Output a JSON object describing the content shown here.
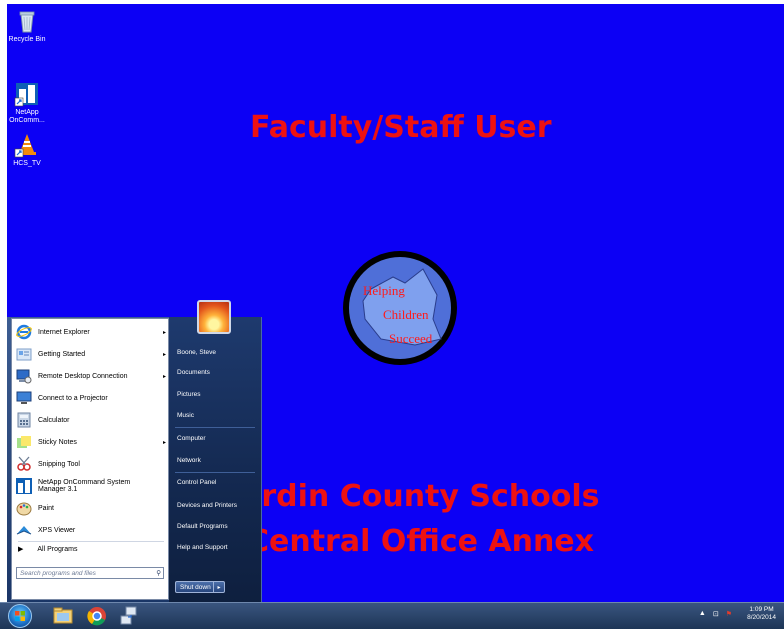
{
  "desktop": {
    "background_color": "#0c00f5",
    "icons": [
      {
        "label": "Recycle Bin",
        "icon": "recycle-bin-icon"
      },
      {
        "label": "NetApp OnComm...",
        "icon": "netapp-icon"
      },
      {
        "label": "HCS_TV",
        "icon": "vlc-cone-icon"
      }
    ],
    "wallpaper_text": {
      "line1": "Faculty/Staff User",
      "line2": "Hardin County Schools",
      "line3": "Central Office Annex",
      "color": "#ee1111"
    },
    "logo_words": [
      "Helping",
      "Children",
      "Succeed"
    ]
  },
  "start_menu": {
    "programs": [
      {
        "label": "Internet Explorer",
        "icon": "internet-explorer-icon",
        "has_submenu": true
      },
      {
        "label": "Getting Started",
        "icon": "getting-started-icon",
        "has_submenu": true
      },
      {
        "label": "Remote Desktop Connection",
        "icon": "remote-desktop-icon",
        "has_submenu": true
      },
      {
        "label": "Connect to a Projector",
        "icon": "projector-icon",
        "has_submenu": false
      },
      {
        "label": "Calculator",
        "icon": "calculator-icon",
        "has_submenu": false
      },
      {
        "label": "Sticky Notes",
        "icon": "sticky-notes-icon",
        "has_submenu": true
      },
      {
        "label": "Snipping Tool",
        "icon": "snipping-tool-icon",
        "has_submenu": false
      },
      {
        "label": "NetApp OnCommand System Manager 3.1",
        "icon": "netapp-icon",
        "has_submenu": false
      },
      {
        "label": "Paint",
        "icon": "paint-icon",
        "has_submenu": false
      },
      {
        "label": "XPS Viewer",
        "icon": "xps-viewer-icon",
        "has_submenu": false
      }
    ],
    "all_programs": "All Programs",
    "search_placeholder": "Search programs and files",
    "right_items": [
      "Boone, Steve",
      "Documents",
      "Pictures",
      "Music",
      "Computer",
      "Network",
      "Control Panel",
      "Devices and Printers",
      "Default Programs",
      "Help and Support"
    ],
    "shutdown_label": "Shut down"
  },
  "taskbar": {
    "pinned": [
      "windows-explorer-icon",
      "chrome-icon",
      "network-tool-icon"
    ],
    "clock_time": "1:09 PM",
    "clock_date": "8/20/2014"
  }
}
